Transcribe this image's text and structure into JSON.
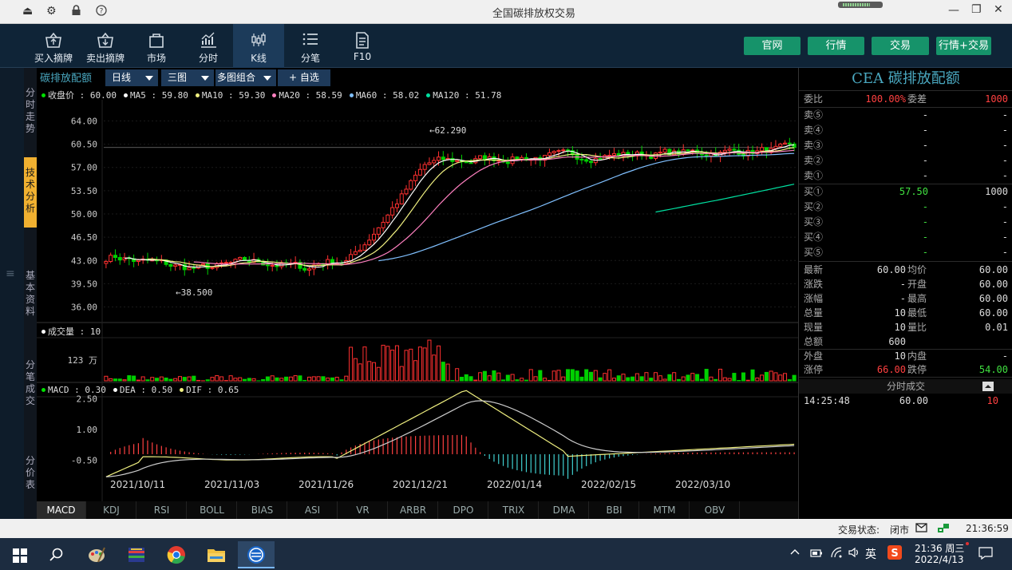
{
  "window": {
    "title": "全国碳排放权交易"
  },
  "toolbar": {
    "buttons": [
      {
        "label": "买入摘牌",
        "icon": "basket-up-icon"
      },
      {
        "label": "卖出摘牌",
        "icon": "basket-down-icon"
      },
      {
        "label": "市场",
        "icon": "bag-icon"
      },
      {
        "label": "分时",
        "icon": "timeline-chart-icon"
      },
      {
        "label": "K线",
        "icon": "candlestick-icon"
      },
      {
        "label": "分笔",
        "icon": "list-icon"
      },
      {
        "label": "F10",
        "icon": "document-icon"
      }
    ],
    "right": [
      "官网",
      "行情",
      "交易",
      "行情+交易"
    ],
    "accent": "#16936a"
  },
  "left_tabs": [
    "分时走势",
    "技术分析",
    "基本资料",
    "分笔成交",
    "分价表"
  ],
  "selector": {
    "name": "碳排放配额",
    "period": "日线",
    "layout": "三图",
    "combo": "多图组合",
    "watch": "+ 自选"
  },
  "legend_price": [
    {
      "label": "收盘价 : 60.00",
      "color": "#00e000"
    },
    {
      "label": "MA5 : 59.80",
      "color": "#ffffff"
    },
    {
      "label": "MA10 : 59.30",
      "color": "#f0f080"
    },
    {
      "label": "MA20 : 58.59",
      "color": "#ff80c0"
    },
    {
      "label": "MA60 : 58.02",
      "color": "#80c0ff"
    },
    {
      "label": "MA120 : 51.78",
      "color": "#00e0a0"
    }
  ],
  "legend_volume": {
    "label": "成交量 : 10",
    "color": "#ffffff"
  },
  "legend_macd": [
    {
      "label": "MACD : 0.30",
      "color": "#00e000"
    },
    {
      "label": "DEA : 0.50",
      "color": "#ffffff"
    },
    {
      "label": "DIF : 0.65",
      "color": "#f0f080"
    }
  ],
  "bottom_tabs": [
    "MACD",
    "KDJ",
    "RSI",
    "BOLL",
    "BIAS",
    "ASI",
    "VR",
    "ARBR",
    "DPO",
    "TRIX",
    "DMA",
    "BBI",
    "MTM",
    "OBV"
  ],
  "chart_data": {
    "type": "candlestick",
    "price_ticks": [
      "64.00",
      "60.50",
      "57.00",
      "53.50",
      "50.00",
      "46.50",
      "43.00",
      "39.50",
      "36.00"
    ],
    "ylim": [
      34.5,
      65.5
    ],
    "max_label": "←62.290",
    "min_label": "←38.500",
    "volume_tick": "123 万",
    "macd_ticks": [
      "2.50",
      "1.00",
      "-0.50"
    ],
    "dates": [
      "2021/10/11",
      "2021/11/03",
      "2021/11/26",
      "2021/12/21",
      "2022/01/14",
      "2022/02/15",
      "2022/03/10"
    ]
  },
  "right": {
    "title": "CEA 碳排放配额",
    "weibi": {
      "label": "委比",
      "value": "100.00%"
    },
    "weicha": {
      "label": "委差",
      "value": "1000"
    },
    "sells": [
      {
        "label": "卖⑤",
        "price": "-",
        "vol": "-"
      },
      {
        "label": "卖④",
        "price": "-",
        "vol": "-"
      },
      {
        "label": "卖③",
        "price": "-",
        "vol": "-"
      },
      {
        "label": "卖②",
        "price": "-",
        "vol": "-"
      },
      {
        "label": "卖①",
        "price": "-",
        "vol": "-"
      }
    ],
    "buys": [
      {
        "label": "买①",
        "price": "57.50",
        "vol": "1000"
      },
      {
        "label": "买②",
        "price": "-",
        "vol": "-"
      },
      {
        "label": "买③",
        "price": "-",
        "vol": "-"
      },
      {
        "label": "买④",
        "price": "-",
        "vol": "-"
      },
      {
        "label": "买⑤",
        "price": "-",
        "vol": "-"
      }
    ],
    "stats": [
      {
        "l1": "最新",
        "v1": "60.00",
        "l2": "均价",
        "v2": "60.00"
      },
      {
        "l1": "涨跌",
        "v1": "-",
        "l2": "开盘",
        "v2": "60.00"
      },
      {
        "l1": "涨幅",
        "v1": "-",
        "l2": "最高",
        "v2": "60.00"
      },
      {
        "l1": "总量",
        "v1": "10",
        "l2": "最低",
        "v2": "60.00"
      },
      {
        "l1": "现量",
        "v1": "10",
        "l2": "量比",
        "v2": "0.01"
      },
      {
        "l1": "总额",
        "v1": "600",
        "l2": "",
        "v2": ""
      }
    ],
    "waipan": {
      "l1": "外盘",
      "v1": "10",
      "l2": "内盘",
      "v2": "-"
    },
    "limits": {
      "l1": "涨停",
      "v1": "66.00",
      "l2": "跌停",
      "v2": "54.00"
    },
    "ticks_header": "分时成交",
    "tick": {
      "time": "14:25:48",
      "price": "60.00",
      "vol": "10"
    }
  },
  "status": {
    "label": "交易状态:",
    "state": "闭市",
    "time": "21:36:59"
  },
  "taskbar": {
    "ime": "英",
    "clock_time": "21:36 周三",
    "clock_date": "2022/4/13"
  }
}
